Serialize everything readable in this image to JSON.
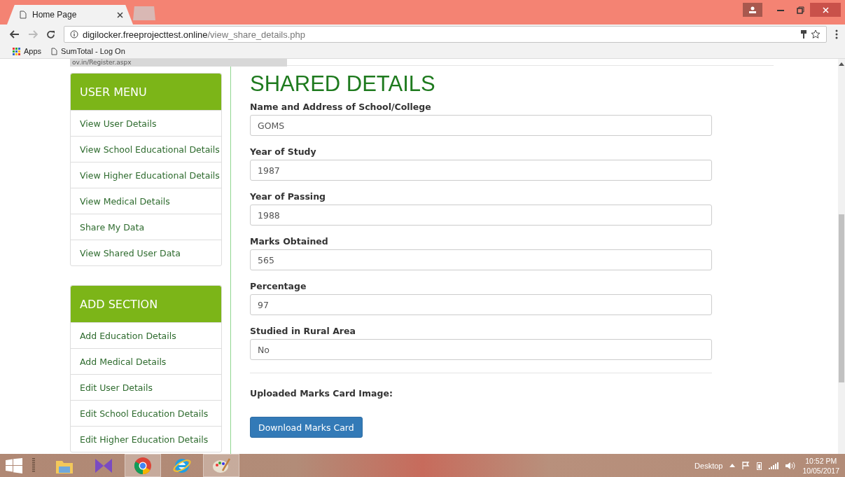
{
  "browser": {
    "tabs": [
      {
        "title": "Home Page",
        "selected": true
      },
      {
        "selected": false
      }
    ],
    "url": {
      "host": "digilocker.freeprojecttest.online",
      "path": "/view_share_details.php"
    },
    "bookmarks": [
      {
        "kind": "apps",
        "label": "Apps"
      },
      {
        "kind": "page",
        "label": "SumTotal - Log On"
      }
    ],
    "status_tooltip": "ov.in/Register.aspx"
  },
  "sidebar": [
    {
      "title": "USER MENU",
      "items": [
        "View User Details",
        "View School Educational Details",
        "View Higher Educational Details",
        "View Medical Details",
        "Share My Data",
        "View Shared User Data"
      ]
    },
    {
      "title": "ADD SECTION",
      "items": [
        "Add Education Details",
        "Add Medical Details",
        "Edit User Details",
        "Edit School Education Details",
        "Edit Higher Education Details"
      ]
    }
  ],
  "main": {
    "title": "SHARED DETAILS",
    "fields": [
      {
        "label": "Name and Address of School/College",
        "value": "GOMS"
      },
      {
        "label": "Year of Study",
        "value": "1987"
      },
      {
        "label": "Year of Passing",
        "value": "1988"
      },
      {
        "label": "Marks Obtained",
        "value": "565"
      },
      {
        "label": "Percentage",
        "value": "97"
      },
      {
        "label": "Studied in Rural Area",
        "value": "No"
      }
    ],
    "image_label": "Uploaded Marks Card Image:",
    "download_button": "Download Marks Card"
  },
  "taskbar": {
    "apps": [
      {
        "kind": "explorer",
        "selected": false
      },
      {
        "kind": "vs",
        "selected": false
      },
      {
        "kind": "chrome",
        "selected": true
      },
      {
        "kind": "ie",
        "selected": false
      },
      {
        "kind": "paint",
        "selected": true
      }
    ],
    "toolbar_label": "Desktop",
    "time": "10:52 PM",
    "date": "10/05/2017"
  }
}
